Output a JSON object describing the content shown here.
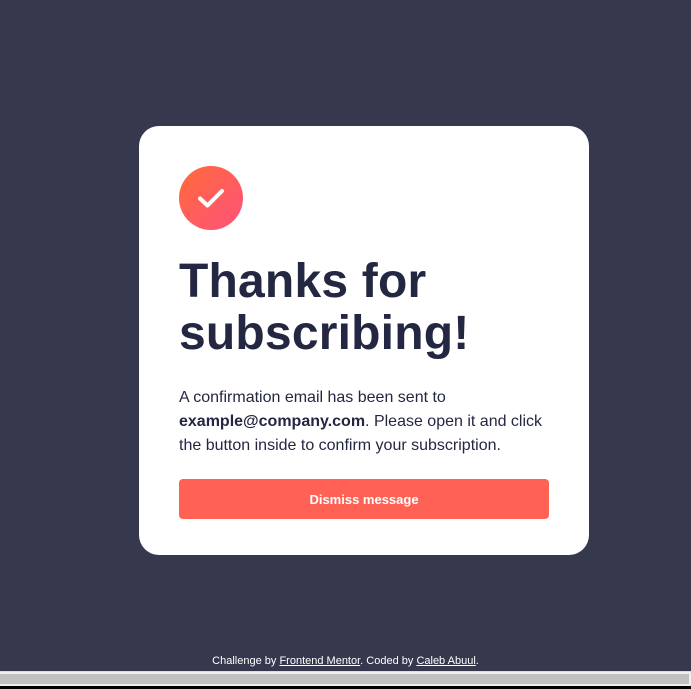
{
  "colors": {
    "background": "#36384e",
    "card": "#ffffff",
    "text": "#242742",
    "accent_button": "#ff6155",
    "badge_gradient_start": "#ff6a3a",
    "badge_gradient_end": "#ff527b"
  },
  "card": {
    "icon": "checkmark-icon",
    "title_line1": "Thanks for",
    "title_line2": "subscribing!",
    "message_before": "A confirmation email has been sent to ",
    "email": "example@company.com",
    "message_after": ". Please open it and click the button inside to confirm your subscription.",
    "dismiss_label": "Dismiss message"
  },
  "footer": {
    "prefix": "Challenge by ",
    "challenge_link": "Frontend Mentor",
    "middle": ". Coded by ",
    "author_link": "Caleb Abuul",
    "suffix": "."
  }
}
